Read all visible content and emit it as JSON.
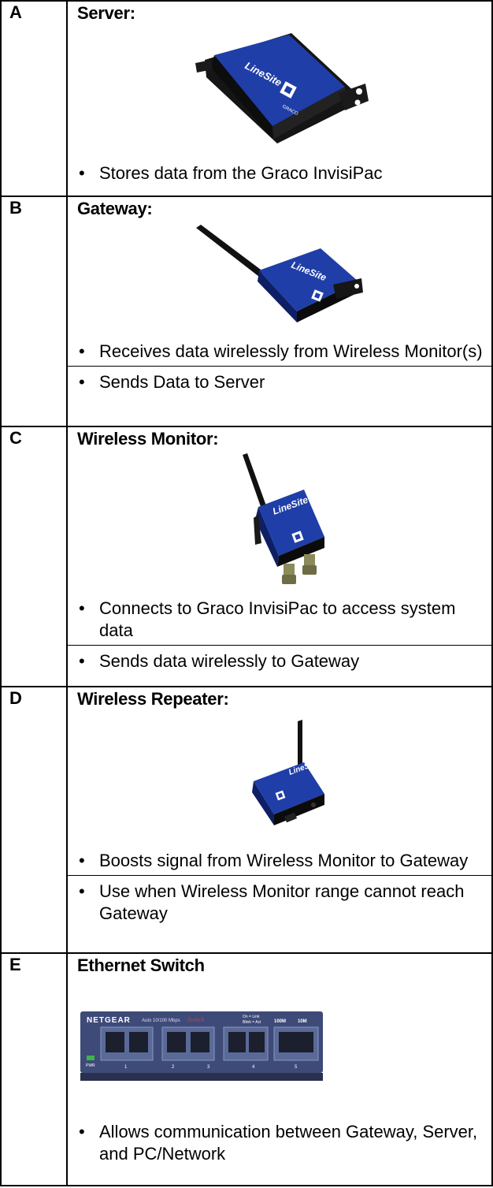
{
  "rows": [
    {
      "letter": "A",
      "title": "Server:",
      "image": "server-device",
      "bullets": [
        "Stores data from the Graco InvisiPac"
      ]
    },
    {
      "letter": "B",
      "title": "Gateway:",
      "image": "gateway-device",
      "bullets": [
        "Receives data wirelessly from Wireless Monitor(s)",
        "Sends Data to Server"
      ]
    },
    {
      "letter": "C",
      "title": "Wireless Monitor:",
      "image": "wireless-monitor-device",
      "bullets": [
        "Connects to Graco InvisiPac to access system data",
        "Sends data wirelessly to Gateway"
      ]
    },
    {
      "letter": "D",
      "title": "Wireless Repeater:",
      "image": "wireless-repeater-device",
      "bullets": [
        "Boosts signal from Wireless Monitor to Gateway",
        "Use when Wireless Monitor range cannot reach Gateway"
      ]
    },
    {
      "letter": "E",
      "title": "Ethernet Switch",
      "image": "ethernet-switch-device",
      "bullets": [
        "Allows communication between Gateway, Server, and PC/Network"
      ]
    }
  ],
  "device_labels": {
    "brand": "LineSite",
    "graco": "GRACO",
    "switch_brand": "NETGEAR",
    "switch_speed": "Auto 10/100 Mbps",
    "switch_model": "Switch",
    "switch_link": "On = Link",
    "switch_act": "Blink = Act",
    "switch_100m": "100M",
    "switch_10m": "10M",
    "switch_pwr": "PWR",
    "switch_ports": [
      "1",
      "2",
      "3",
      "4",
      "5"
    ]
  },
  "colors": {
    "device_blue": "#1f3ea8",
    "device_dark": "#151515",
    "switch_body": "#3e4a78"
  }
}
